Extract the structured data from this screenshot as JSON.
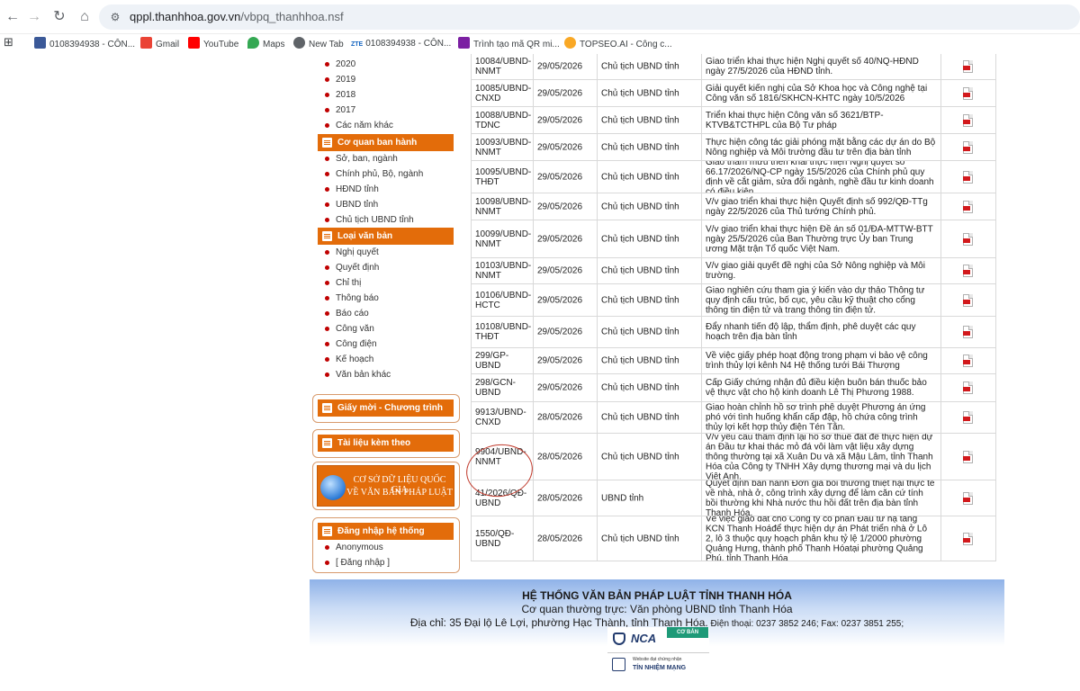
{
  "browser": {
    "url_host": "qppl.thanhhoa.gov.vn",
    "url_path": "/vbpq_thanhhoa.nsf",
    "bookmarks": [
      {
        "label": "0108394938 - CÔN...",
        "color": "#3b5998"
      },
      {
        "label": "Gmail",
        "color": "#ea4335"
      },
      {
        "label": "YouTube",
        "color": "#ff0000"
      },
      {
        "label": "Maps",
        "color": "#34a853"
      },
      {
        "label": "New Tab",
        "color": "#5f6368"
      },
      {
        "label": "0108394938 - CÔN...",
        "color": "#1565c0"
      },
      {
        "label": "Trình tạo mã QR mi...",
        "color": "#7b1fa2"
      },
      {
        "label": "TOPSEO.AI - Công c...",
        "color": "#f9a825"
      }
    ],
    "zte_prefix": "ZTE"
  },
  "sidebar": {
    "years": [
      "2020",
      "2019",
      "2018",
      "2017",
      "Các năm khác"
    ],
    "agency_header": "Cơ quan ban hành",
    "agencies": [
      "Sở, ban, ngành",
      "Chính phủ, Bộ, ngành",
      "HĐND tỉnh",
      "UBND tỉnh",
      "Chủ tịch UBND tỉnh"
    ],
    "type_header": "Loại văn bản",
    "types": [
      "Nghị quyết",
      "Quyết định",
      "Chỉ thị",
      "Thông báo",
      "Báo cáo",
      "Công văn",
      "Công điện",
      "Kế hoạch",
      "Văn bản khác"
    ],
    "invite_header": "Giấy mời - Chương trình",
    "attach_header": "Tài liệu kèm theo",
    "banner_line1": "CƠ SỞ DỮ LIỆU QUỐC GIA",
    "banner_line2": "VỀ VĂN BẢN PHÁP LUẬT",
    "login_header": "Đăng nhập hệ thống",
    "login_items": [
      "Anonymous",
      "[ Đăng nhập ]"
    ]
  },
  "documents": [
    {
      "num": "10084/UBND-NNMT",
      "date": "29/05/2026",
      "authority": "Chủ tịch UBND tỉnh",
      "summary": "Giao triển khai thực hiện Nghị quyết số 40/NQ-HĐND ngày 27/5/2026 của HĐND tỉnh."
    },
    {
      "num": "10085/UBND-CNXD",
      "date": "29/05/2026",
      "authority": "Chủ tịch UBND tỉnh",
      "summary": "Giải quyết kiến nghị của Sở Khoa học và Công nghệ tại Công văn số 1816/SKHCN-KHTC ngày 10/5/2026"
    },
    {
      "num": "10088/UBND-TDNC",
      "date": "29/05/2026",
      "authority": "Chủ tịch UBND tỉnh",
      "summary": "Triển khai thực hiện Công văn số 3621/BTP-KTVB&TCTHPL của Bộ Tư pháp"
    },
    {
      "num": "10093/UBND-NNMT",
      "date": "29/05/2026",
      "authority": "Chủ tịch UBND tỉnh",
      "summary": "Thực hiện công tác giải phóng mặt bằng các dự án do Bộ Nông nghiệp và Môi trường đầu tư trên địa bàn tỉnh"
    },
    {
      "num": "10095/UBND-THĐT",
      "date": "29/05/2026",
      "authority": "Chủ tịch UBND tỉnh",
      "summary": "Giao tham mưu triển khai thực hiện Nghị quyết số 66.17/2026/NQ-CP ngày 15/5/2026 của Chính phủ quy định về cắt giảm, sửa đổi ngành, nghề đầu tư kinh doanh có điều kiện"
    },
    {
      "num": "10098/UBND-NNMT",
      "date": "29/05/2026",
      "authority": "Chủ tịch UBND tỉnh",
      "summary": "V/v giao triển khai thực hiện Quyết định số 992/QĐ-TTg ngày 22/5/2026 của Thủ tướng Chính phủ."
    },
    {
      "num": "10099/UBND-NNMT",
      "date": "29/05/2026",
      "authority": "Chủ tịch UBND tỉnh",
      "summary": "V/v giao triển khai thực hiện Đề án số 01/ĐA-MTTW-BTT ngày 25/5/2026 của Ban Thường trực Ủy ban Trung ương Mặt trận Tổ quốc Việt Nam."
    },
    {
      "num": "10103/UBND-NNMT",
      "date": "29/05/2026",
      "authority": "Chủ tịch UBND tỉnh",
      "summary": "V/v giao giải quyết đề nghị của Sở Nông nghiệp và Môi trường."
    },
    {
      "num": "10106/UBND-HCTC",
      "date": "29/05/2026",
      "authority": "Chủ tịch UBND tỉnh",
      "summary": "Giao nghiên cứu tham gia ý kiến vào dự thảo Thông tư quy định cấu trúc, bố cục, yêu cầu kỹ thuật cho cổng thông tin điện tử và trang thông tin điện tử."
    },
    {
      "num": "10108/UBND-THĐT",
      "date": "29/05/2026",
      "authority": "Chủ tịch UBND tỉnh",
      "summary": "Đẩy nhanh tiến độ lập, thẩm định, phê duyệt các quy hoạch trên địa bàn tỉnh"
    },
    {
      "num": "299/GP-UBND",
      "date": "29/05/2026",
      "authority": "Chủ tịch UBND tỉnh",
      "summary": "Về việc giấy phép hoạt động trong phạm vi bảo vệ công trình thủy lợi kênh N4 Hệ thống tưới Bái Thượng"
    },
    {
      "num": "298/GCN-UBND",
      "date": "29/05/2026",
      "authority": "Chủ tịch UBND tỉnh",
      "summary": "Cấp Giấy chứng nhận đủ điều kiện buôn bán thuốc bảo vệ thực vật cho hộ kinh doanh Lê Thị Phương 1988."
    },
    {
      "num": "9913/UBND-CNXD",
      "date": "28/05/2026",
      "authority": "Chủ tịch UBND tỉnh",
      "summary": "Giao hoàn chỉnh hồ sơ trình phê duyệt Phương án ứng phó với tình huống khẩn cấp đập, hồ chứa công trình thủy lợi kết hợp thủy điện Tén Tằn."
    },
    {
      "num": "9904/UBND-NNMT",
      "date": "28/05/2026",
      "authority": "Chủ tịch UBND tỉnh",
      "summary": "V/v yêu cầu thẩm định lại hồ sơ thuê đất để thực hiện dự án Đầu tư khai thác mỏ đá vôi làm vật liệu xây dựng thông thường tại xã Xuân Du và xã Mậu Lâm, tỉnh Thanh Hóa của Công ty TNHH Xây dựng thương mại và du lịch Việt Anh."
    },
    {
      "num": "41/2026/QĐ-UBND",
      "date": "28/05/2026",
      "authority": "UBND tỉnh",
      "summary": "Quyết định ban hành Đơn giá bồi thường thiệt hại thực tế về nhà, nhà ở, công trình xây dựng để làm căn cứ tính bồi thường khi Nhà nước thu hồi đất trên địa bàn tỉnh Thanh Hóa."
    },
    {
      "num": "1550/QĐ-UBND",
      "date": "28/05/2026",
      "authority": "Chủ tịch UBND tỉnh",
      "summary": "Về việc giao đất cho Công ty cổ phần Đầu tư hạ tầng KCN Thanh Hoáđể thực hiện dự án Phát triển nhà ở Lô 2, lô 3 thuộc quy hoạch phân khu tỷ lệ 1/2000 phường Quảng Hưng, thành phố Thanh Hóatại phường Quảng Phú, tỉnh Thanh Hóa"
    }
  ],
  "footer": {
    "title": "HỆ THỐNG VĂN BẢN PHÁP LUẬT TỈNH THANH HÓA",
    "line2": "Cơ quan thường trực: Văn phòng UBND tỉnh Thanh Hóa",
    "address": "Địa chỉ: 35 Đại lộ Lê Lợi, phường Hạc Thành, tỉnh Thanh Hóa.",
    "phone": " Điện thoại: 0237 3852 246; Fax: 0237 3851 255;",
    "nca_text": "NCA",
    "nca_badge": "CƠ BẢN",
    "nca_sub": "Website đạt chứng nhận",
    "nca_main": "TÍN NHIỆM MẠNG"
  },
  "colors": {
    "accent": "#e36c0a",
    "bullet": "#c00000",
    "pdf": "#d2191c"
  }
}
